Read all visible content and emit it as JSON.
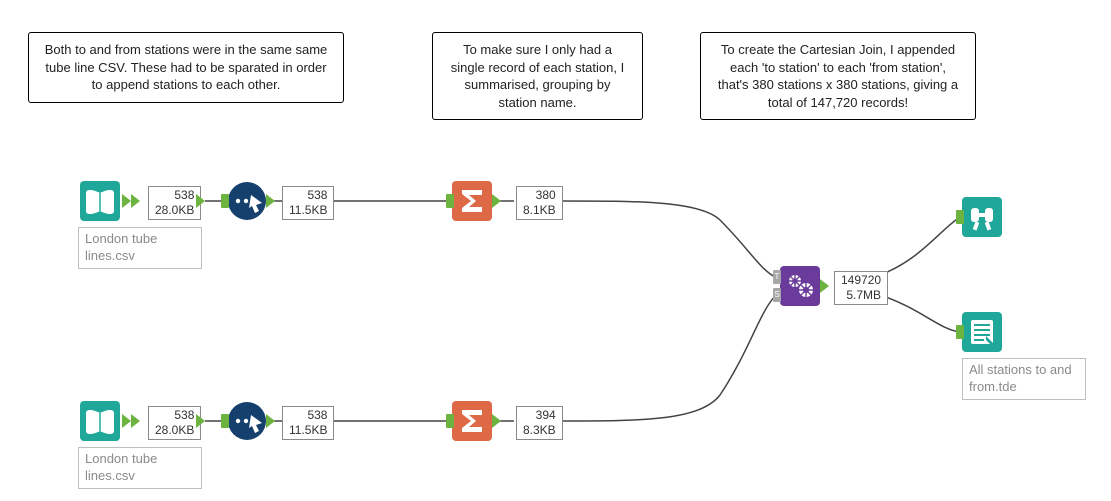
{
  "comments": {
    "c1": "Both to and from stations were in the same same tube line CSV. These had to be sparated in order to append stations to each other.",
    "c2": "To make sure I only had a single record of each station, I summarised, grouping by station name.",
    "c3": "To create the Cartesian Join, I appended each 'to station' to each 'from station', that's 380 stations x 380 stations, giving a total of 147,720 records!"
  },
  "files": {
    "input_top": "London tube lines.csv",
    "input_bottom": "London tube lines.csv",
    "output": "All stations to and from.tde"
  },
  "stats": {
    "top_in": {
      "records": "538",
      "size": "28.0KB"
    },
    "top_sel": {
      "records": "538",
      "size": "11.5KB"
    },
    "top_sum": {
      "records": "380",
      "size": "8.1KB"
    },
    "bot_in": {
      "records": "538",
      "size": "28.0KB"
    },
    "bot_sel": {
      "records": "538",
      "size": "11.5KB"
    },
    "bot_sum": {
      "records": "394",
      "size": "8.3KB"
    },
    "append": {
      "records": "149720",
      "size": "5.7MB"
    }
  },
  "colors": {
    "teal": "#1fa89a",
    "navy": "#153f6d",
    "orange": "#de6947",
    "purple": "#6a3b9b",
    "green_conn": "#6db33f",
    "grey": "#9b9b9b"
  },
  "icons": {
    "input": "open-book",
    "select": "checkmark-dots",
    "summarize": "sigma",
    "append": "gears",
    "browse": "binoculars",
    "output": "document-lines"
  }
}
